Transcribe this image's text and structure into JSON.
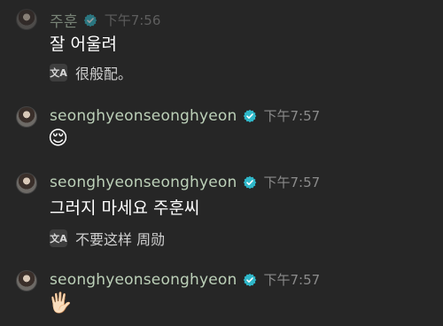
{
  "messages": [
    {
      "sender": "주훈",
      "time": "下午7:56",
      "text": "잘 어울려",
      "translation": "很般配。"
    },
    {
      "sender": "seonghyeonseonghyeon",
      "time": "下午7:57",
      "emoji": "😌"
    },
    {
      "sender": "seonghyeonseonghyeon",
      "time": "下午7:57",
      "text": "그러지 마세요 주훈씨",
      "translation": "不要这样 周勋"
    },
    {
      "sender": "seonghyeonseonghyeon",
      "time": "下午7:57",
      "emoji": "🖐🏻"
    }
  ],
  "icons": {
    "translate": "translate-icon",
    "verified": "verified-badge-icon"
  },
  "colors": {
    "background": "#262626",
    "sender_name": "#bcd0b8",
    "verified_badge": "#2fb7c9",
    "timestamp": "#8b8b8b"
  }
}
